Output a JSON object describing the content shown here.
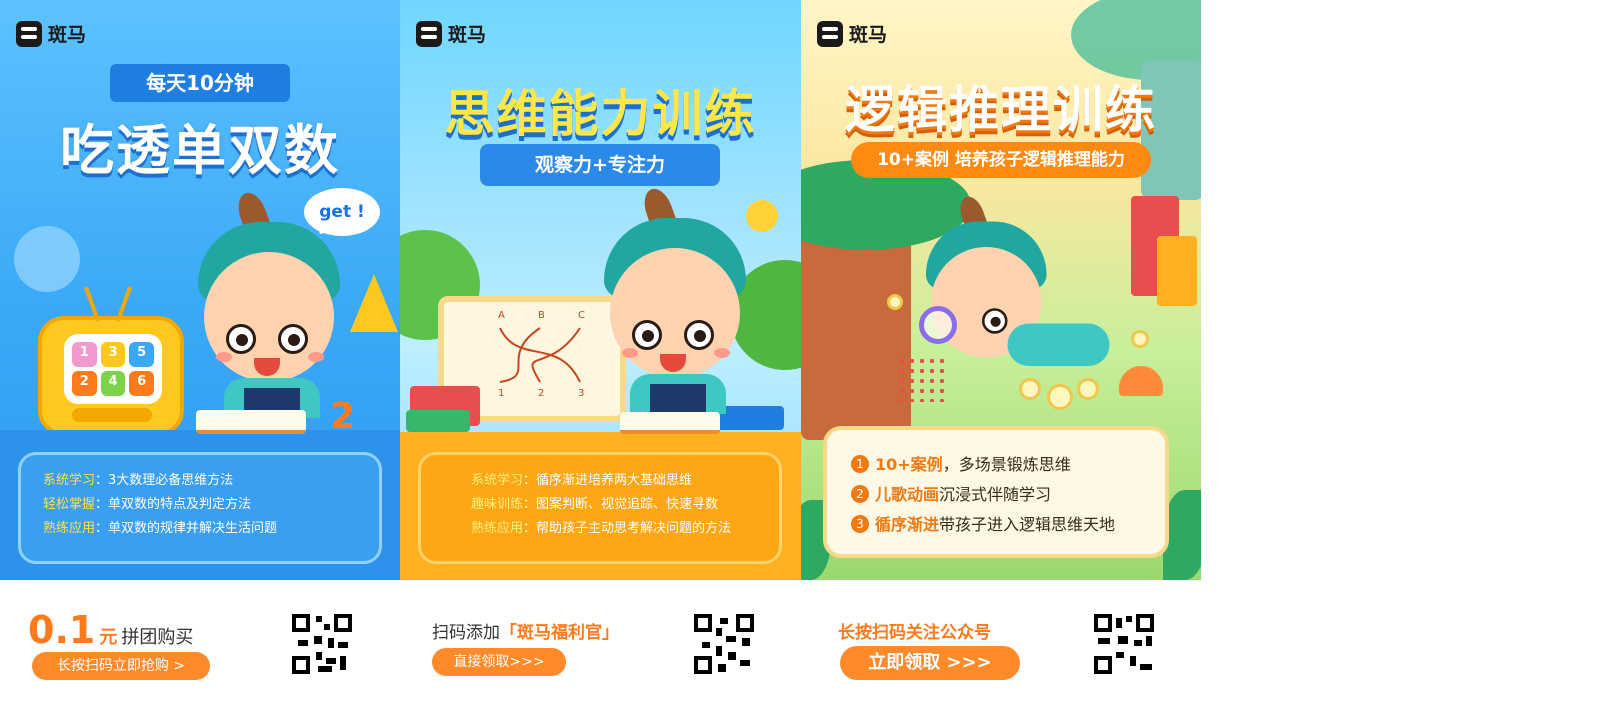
{
  "brand": {
    "name": "斑马"
  },
  "panel1": {
    "ribbon": "每天10分钟",
    "headline": "吃透单双数",
    "bubble": "get !",
    "tv_numbers": [
      "1",
      "3",
      "5",
      "2",
      "4",
      "6"
    ],
    "tv_colors": [
      "#f29ad0",
      "#ffc81f",
      "#3aa8f7",
      "#ff7a1a",
      "#7cd34a",
      "#ff7a1a"
    ],
    "desk_number": "2",
    "items": [
      {
        "key": "系统学习",
        "sep": "：",
        "text": "3大数理必备思维方法"
      },
      {
        "key": "轻松掌握",
        "sep": "：",
        "text": "单双数的特点及判定方法"
      },
      {
        "key": "熟练应用",
        "sep": "：",
        "text": "单双数的规律并解决生活问题"
      }
    ]
  },
  "panel2": {
    "headline": "思维能力训练",
    "ribbon": "观察力+专注力",
    "easel_labels": [
      "A",
      "B",
      "C",
      "1",
      "2",
      "3"
    ],
    "items": [
      {
        "key": "系统学习",
        "sep": "：",
        "text": "循序渐进培养两大基础思维"
      },
      {
        "key": "趣味训练",
        "sep": "：",
        "text": "图案判断、视觉追踪、快速寻数"
      },
      {
        "key": "熟练应用",
        "sep": "：",
        "text": "帮助孩子主动思考解决问题的方法"
      }
    ]
  },
  "panel3": {
    "headline": "逻辑推理训练",
    "ribbon": "10+案例  培养孩子逻辑推理能力",
    "items": [
      {
        "n": "1",
        "key": "10+案例",
        "text": "，多场景锻炼思维"
      },
      {
        "n": "2",
        "key": "儿歌动画",
        "text": "沉浸式伴随学习"
      },
      {
        "n": "3",
        "key": "循序渐进",
        "text": "带孩子进入逻辑思维天地"
      }
    ]
  },
  "bottom": {
    "price": "0.1",
    "price_unit": "元",
    "price_text": "拼团购买",
    "buy_button": "长按扫码立即抢购 >",
    "add_prefix": "扫码添加",
    "add_name": "「斑马福利官」",
    "add_button": "直接领取>>>",
    "follow_text": "长按扫码关注公众号",
    "follow_button": "立即领取 >>>",
    "accent_color": "#ff7a1a"
  }
}
